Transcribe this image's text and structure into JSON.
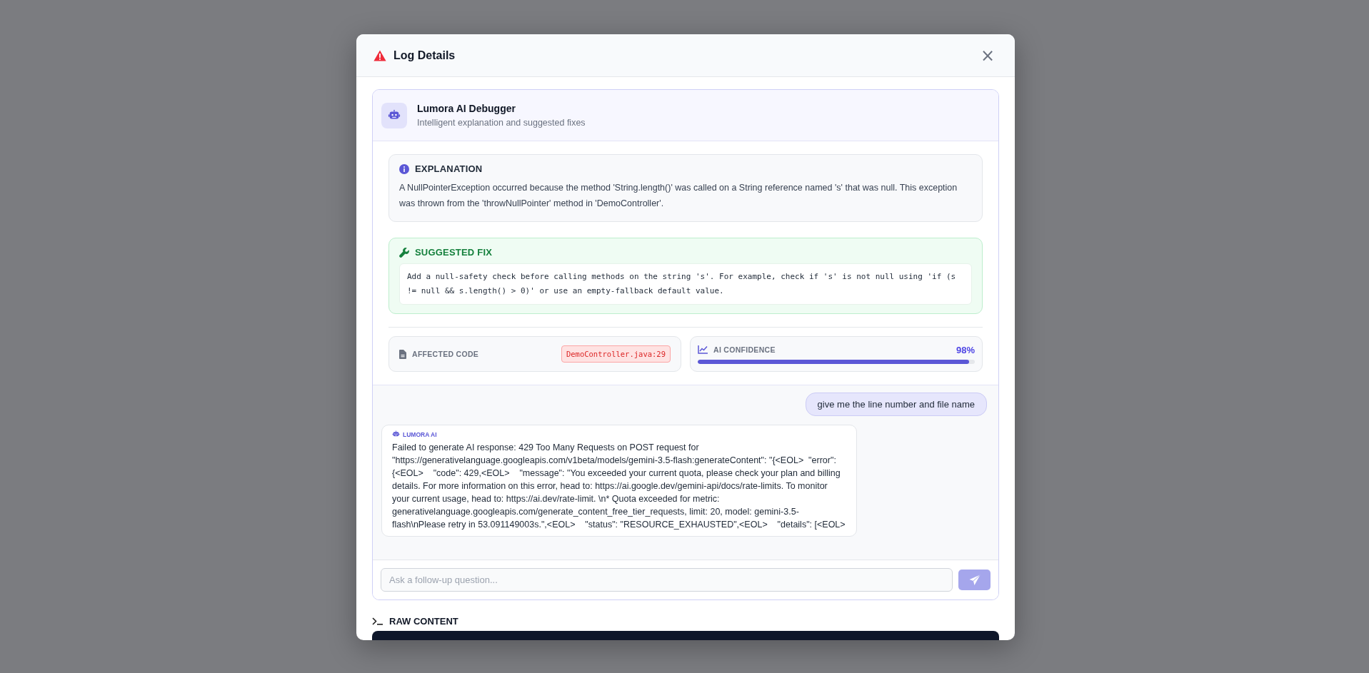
{
  "modal": {
    "title": "Log Details",
    "close": "×"
  },
  "debugger": {
    "title": "Lumora AI Debugger",
    "subtitle": "Intelligent explanation and suggested fixes",
    "explanation": {
      "heading": "EXPLANATION",
      "text": "A NullPointerException occurred because the method 'String.length()' was called on a String reference named 's' that was null. This exception was thrown from the 'throwNullPointer' method in 'DemoController'."
    },
    "suggested_fix": {
      "heading": "SUGGESTED FIX",
      "text": "Add a null-safety check before calling methods on the string 's'. For example, check if 's' is not null using 'if (s != null && s.length() > 0)' or use an empty-fallback default value."
    },
    "affected_code": {
      "label": "AFFECTED CODE",
      "value": "DemoController.java:29"
    },
    "confidence": {
      "label": "AI CONFIDENCE",
      "reading": "98%",
      "level": 0.98
    }
  },
  "chat": {
    "messages": [
      {
        "kind": "user",
        "text": "give me the line number and file name"
      },
      {
        "kind": "ai",
        "sender": "LUMORA AI",
        "text": "Failed to generate AI response: 429 Too Many Requests on POST request for \"https://generativelanguage.googleapis.com/v1beta/models/gemini-3.5-flash:generateContent\": \"{<EOL>  \"error\": {<EOL>    \"code\": 429,<EOL>    \"message\": \"You exceeded your current quota, please check your plan and billing details. For more information on this error, head to: https://ai.google.dev/gemini-api/docs/rate-limits. To monitor your current usage, head to: https://ai.dev/rate-limit. \\n* Quota exceeded for metric: generativelanguage.googleapis.com/generate_content_free_tier_requests, limit: 20, model: gemini-3.5-flash\\nPlease retry in 53.091149003s.\",<EOL>    \"status\": \"RESOURCE_EXHAUSTED\",<EOL>    \"details\": [<EOL>"
      }
    ],
    "input": {
      "placeholder": "Ask a follow-up question..."
    }
  },
  "raw_content": {
    "heading": "RAW CONTENT"
  }
}
